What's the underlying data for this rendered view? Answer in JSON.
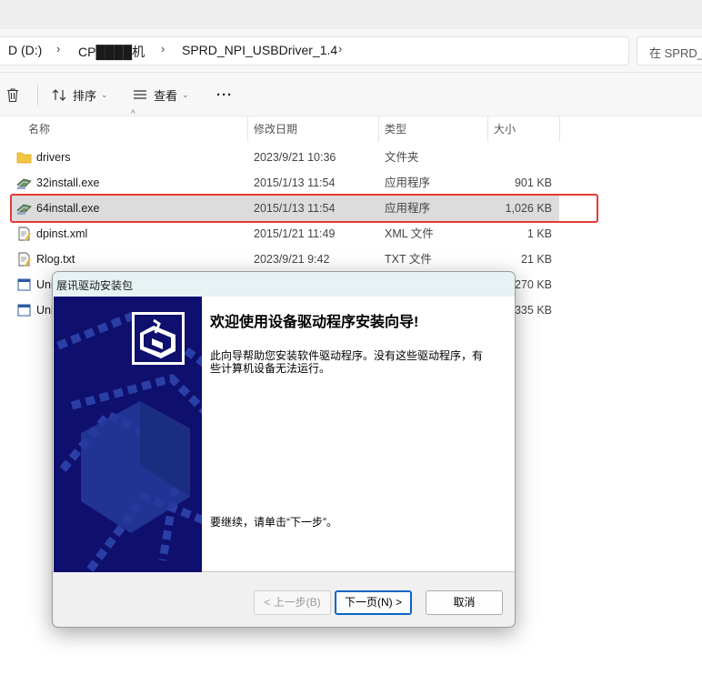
{
  "address_bar": {
    "crumbs": [
      "D (D:)",
      "CP████机",
      "SPRD_NPI_USBDriver_1.4"
    ],
    "search_placeholder": "在 SPRD_"
  },
  "toolbar": {
    "sort_label": "排序",
    "view_label": "查看",
    "more_label": "···"
  },
  "columns": {
    "name": "名称",
    "date": "修改日期",
    "type": "类型",
    "size": "大小"
  },
  "files": [
    {
      "name": "drivers",
      "date": "2023/9/21 10:36",
      "type": "文件夹",
      "size": "",
      "icon": "folder-icon"
    },
    {
      "name": "32install.exe",
      "date": "2015/1/13 11:54",
      "type": "应用程序",
      "size": "901 KB",
      "icon": "installer-icon"
    },
    {
      "name": "64install.exe",
      "date": "2015/1/13 11:54",
      "type": "应用程序",
      "size": "1,026 KB",
      "icon": "installer-icon",
      "selected": true
    },
    {
      "name": "dpinst.xml",
      "date": "2015/1/21 11:49",
      "type": "XML 文件",
      "size": "1 KB",
      "icon": "xml-file-icon"
    },
    {
      "name": "Rlog.txt",
      "date": "2023/9/21 9:42",
      "type": "TXT 文件",
      "size": "21 KB",
      "icon": "text-file-icon"
    },
    {
      "name": "Uni",
      "date": "",
      "type": "",
      "size": "270 KB",
      "icon": "app-file-icon"
    },
    {
      "name": "Uni",
      "date": "",
      "type": "",
      "size": "335 KB",
      "icon": "app-file-icon"
    }
  ],
  "dialog": {
    "title": "展讯驱动安装包",
    "heading": "欢迎使用设备驱动程序安装向导!",
    "description": "此向导帮助您安装软件驱动程序。没有这些驱动程序，有些计算机设备无法运行。",
    "continue_text": "要继续，请单击“下一步”。",
    "back_button": "< 上一步(B)",
    "next_button": "下一页(N) >",
    "cancel_button": "取消"
  },
  "colors": {
    "highlight": "#e53935",
    "wizard_panel": "#0f0f6d",
    "selected_row": "#dcdcdc"
  }
}
